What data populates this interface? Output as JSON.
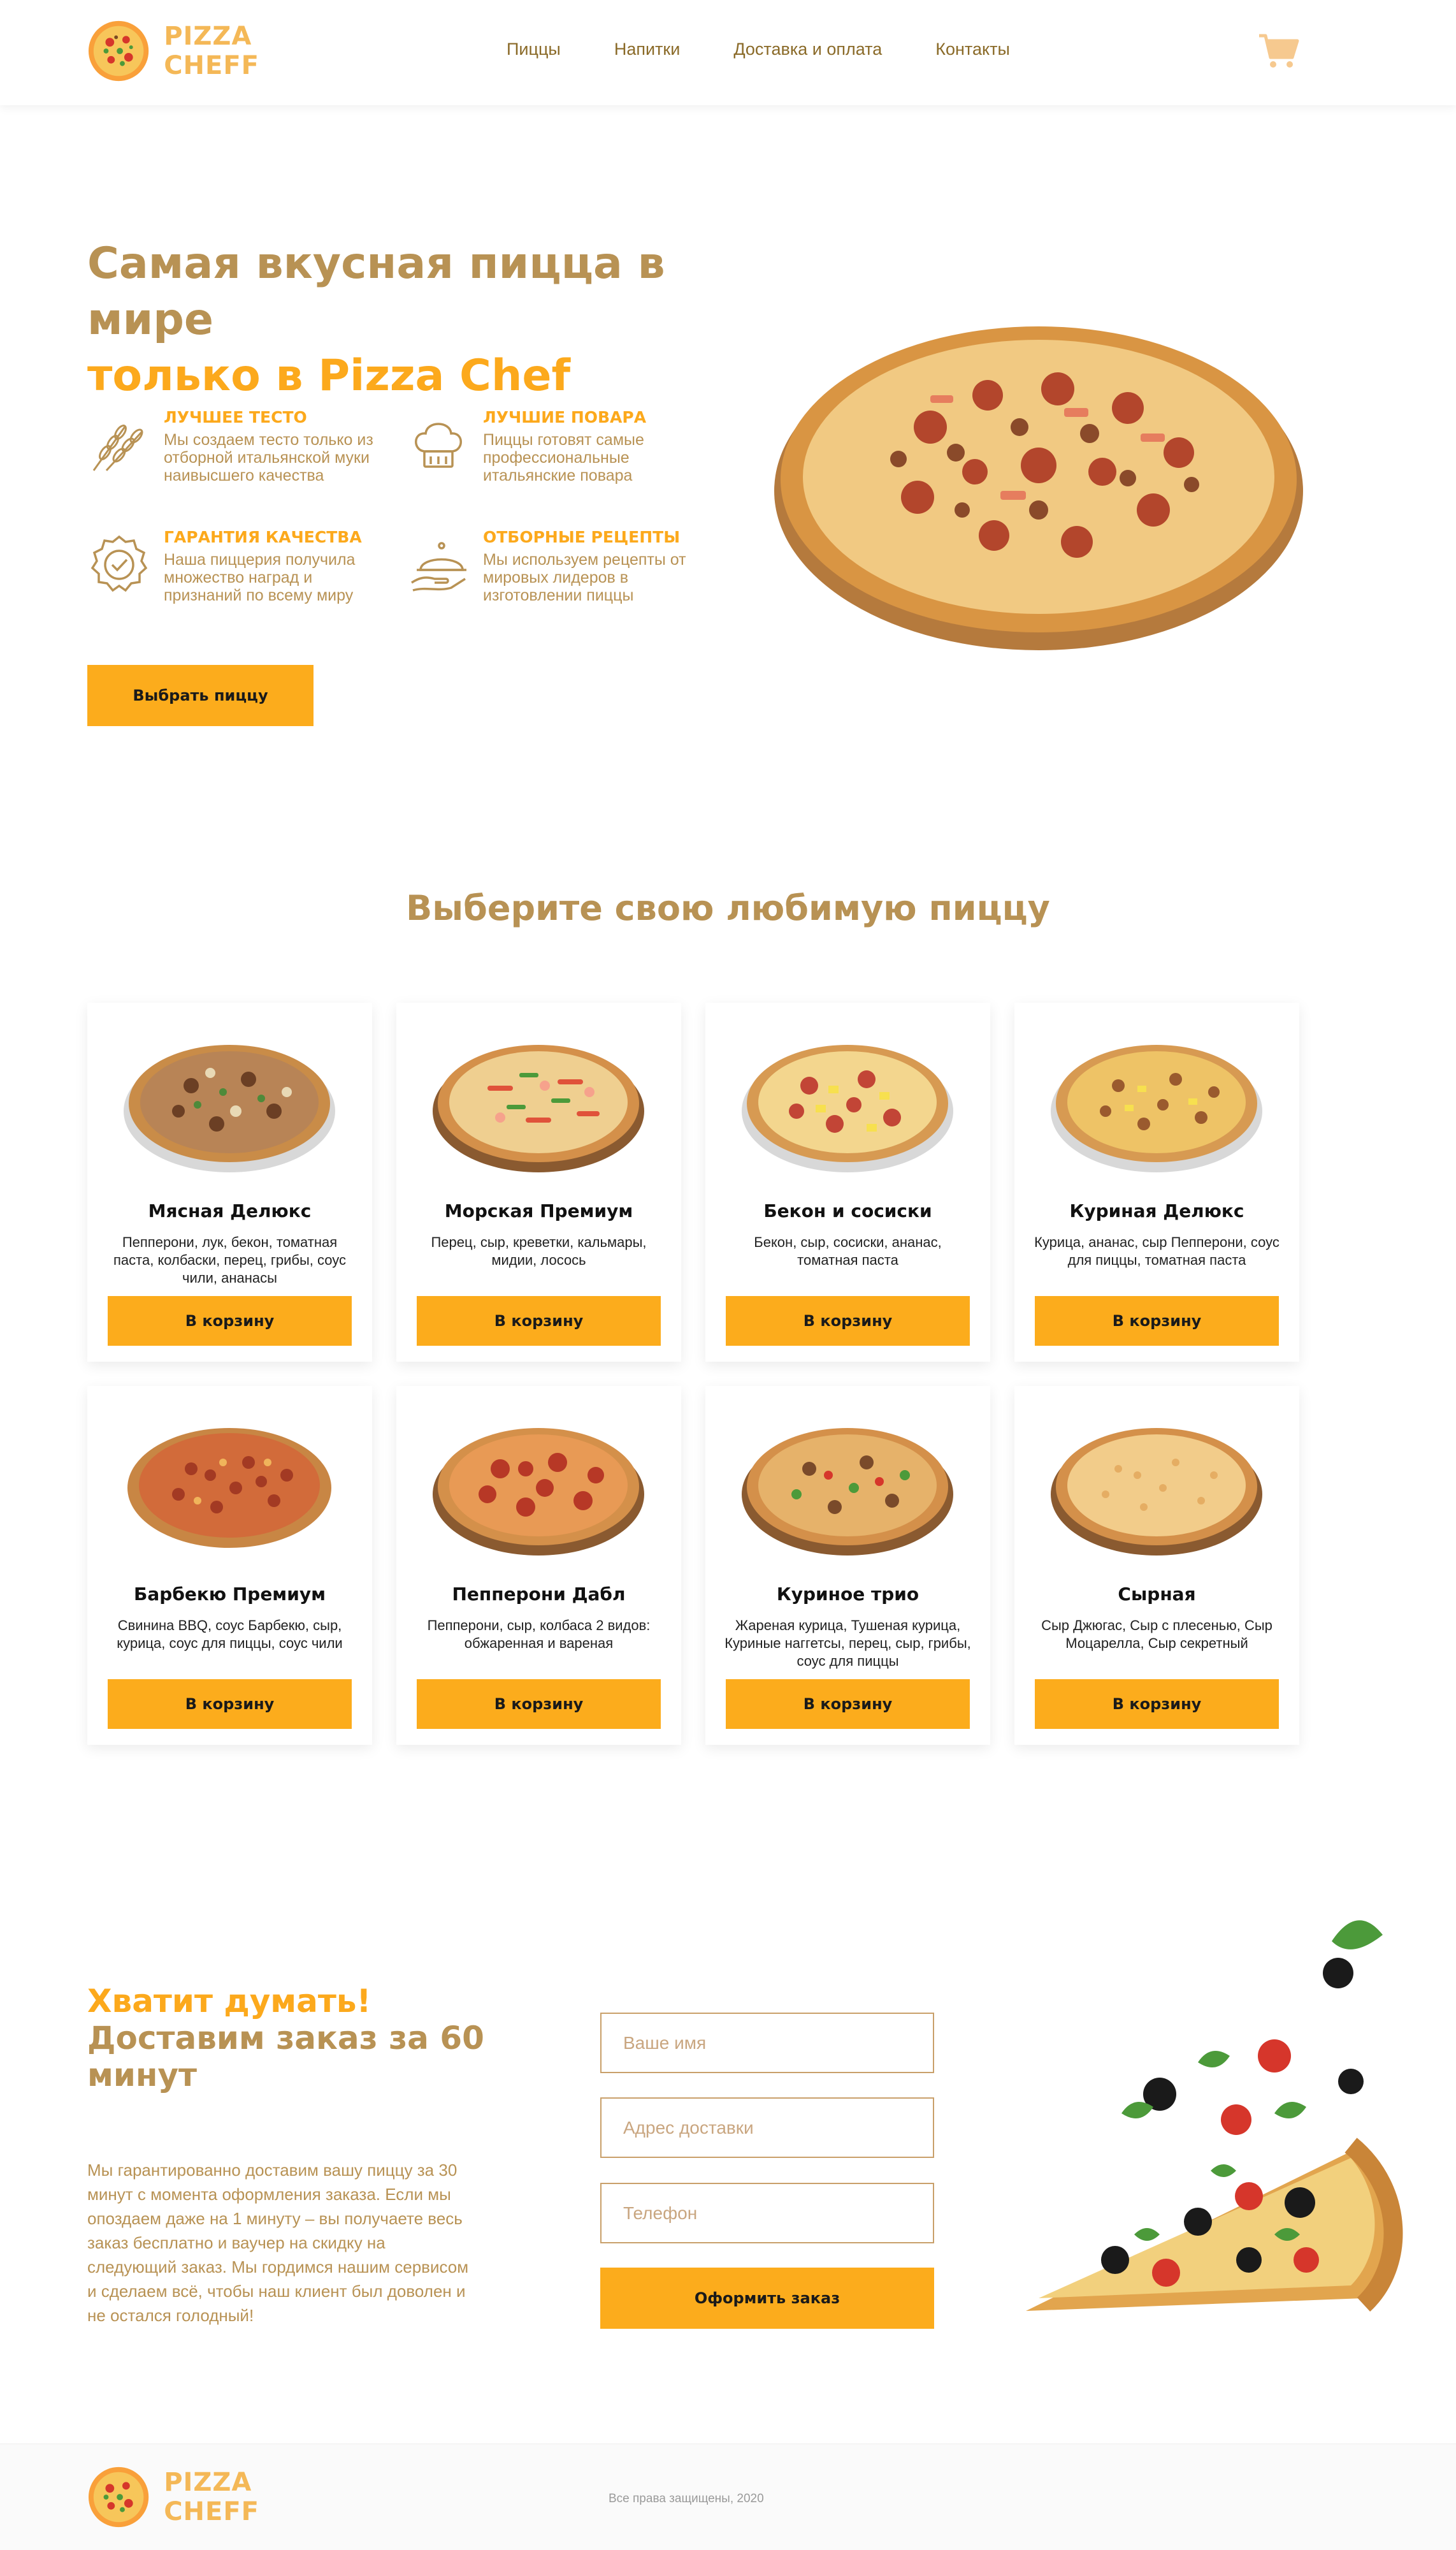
{
  "header": {
    "logo_line1": "PIZZA",
    "logo_line2": "CHEFF",
    "nav": [
      "Пиццы",
      "Напитки",
      "Доставка и оплата",
      "Контакты"
    ],
    "cart_icon": "shopping-cart-icon"
  },
  "hero": {
    "title_line1": "Самая вкусная пицца в мире",
    "title_line2_prefix": "только в ",
    "title_line2_brand": "Pizza Chef",
    "features": [
      {
        "icon": "wheat-icon",
        "title": "ЛУЧШЕЕ ТЕСТО",
        "desc": "Мы создаем тесто только из отборной итальянской муки наивысшего качества"
      },
      {
        "icon": "chef-hat-icon",
        "title": "ЛУЧШИЕ ПОВАРА",
        "desc": "Пиццы готовят самые профессиональные итальянские повара"
      },
      {
        "icon": "quality-badge-icon",
        "title": "ГАРАНТИЯ КАЧЕСТВА",
        "desc": "Наша пиццерия получила множество наград и признаний по всему миру"
      },
      {
        "icon": "serving-dish-icon",
        "title": "ОТБОРНЫЕ РЕЦЕПТЫ",
        "desc": "Мы используем рецепты от мировых лидеров в изготовлении пиццы"
      }
    ],
    "cta": "Выбрать пиццу"
  },
  "menu": {
    "title": "Выберите свою любимую пиццу",
    "button_label": "В корзину",
    "items": [
      {
        "name": "Мясная Делюкс",
        "desc": "Пепперони, лук, бекон, томатная паста, колбаски, перец, грибы, соус чили, ананасы"
      },
      {
        "name": "Морская Премиум",
        "desc": "Перец, сыр, креветки, кальмары, мидии, лосось"
      },
      {
        "name": "Бекон и сосиски",
        "desc": "Бекон, сыр, сосиски, ананас, томатная паста"
      },
      {
        "name": "Куриная Делюкс",
        "desc": "Курица, ананас, сыр Пепперони, соус для пиццы, томатная паста"
      },
      {
        "name": "Барбекю Премиум",
        "desc": "Свинина BBQ, соус Барбекю, сыр, курица, соус для пиццы, соус чили"
      },
      {
        "name": "Пепперони Дабл",
        "desc": "Пепперони, сыр, колбаса 2 видов: обжаренная и вареная"
      },
      {
        "name": "Куриное трио",
        "desc": "Жареная курица, Тушеная курица, Куриные наггетсы, перец, сыр, грибы, соус для пиццы"
      },
      {
        "name": "Сырная",
        "desc": "Сыр Джюгас, Сыр с плесенью, Сыр Моцарелла, Сыр секретный"
      }
    ]
  },
  "order": {
    "title_line1": "Хватит думать!",
    "title_line2": "Доставим заказ за 60 минут",
    "text": "Мы гарантированно доставим вашу пиццу за 30 минут с момента оформления заказа. Если мы опоздаем даже на 1 минуту – вы получаете весь заказ бесплатно и ваучер на скидку на следующий заказ. Мы гордимся нашим сервисом и сделаем всё, чтобы наш клиент был доволен и не остался голодный!",
    "name_placeholder": "Ваше имя",
    "address_placeholder": "Адрес доставки",
    "phone_placeholder": "Телефон",
    "submit": "Оформить заказ"
  },
  "footer": {
    "logo_line1": "PIZZA",
    "logo_line2": "CHEFF",
    "copyright": "Все права защищены, 2020"
  },
  "colors": {
    "accent": "#fcac1c",
    "brown": "#b89254",
    "logo": "#f4b857"
  }
}
